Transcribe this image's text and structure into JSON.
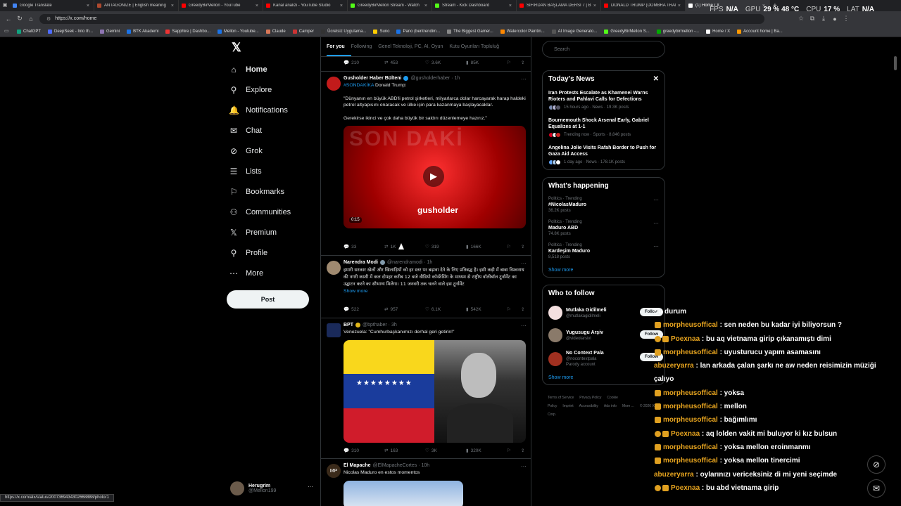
{
  "tabs": [
    {
      "label": "Google Translate",
      "color": "#4285f4"
    },
    {
      "label": "ANTAGONIZE | English meaning",
      "color": "#b04a2f"
    },
    {
      "label": "GreedyBirMellon - YouTube",
      "color": "#ff0000"
    },
    {
      "label": "Kanal analizi - YouTube Studio",
      "color": "#ff0000"
    },
    {
      "label": "GreedyBirMellon Stream - Watch",
      "color": "#53fc18"
    },
    {
      "label": "Stream - Kick Dashboard",
      "color": "#53fc18"
    },
    {
      "label": "SIFIRDAN BAŞLAMA DERSİ 7 | BU",
      "color": "#ff0000"
    },
    {
      "label": "DONALD TRUMP (DOMBRA TRAP",
      "color": "#ff0000"
    },
    {
      "label": "(1) Home / X",
      "color": "#ffffff"
    }
  ],
  "overlay": {
    "fps_label": "FPS",
    "fps": "N/A",
    "gpu_label": "GPU",
    "gpu": "29 % 48 °C",
    "cpu_label": "CPU",
    "cpu": "17 %",
    "lat_label": "LAT",
    "lat": "N/A"
  },
  "url": "https://x.com/home",
  "bookmarks": [
    "ChatGPT",
    "DeepSeek - Into th...",
    "Gemini",
    "BTK Akademi",
    "Sapphire | Dashbo...",
    "Mellon - Youtube...",
    "Claude",
    "Camper",
    "Ücretsiz Uygulama...",
    "Suno",
    "Pano (bentrendim...",
    "The Biggest Gamer...",
    "Watercolor Paintin...",
    "AI Image Generato...",
    "GreedyBirMellon S...",
    "greedybirmellon -...",
    "Home / X",
    "Account home | Ba..."
  ],
  "nav": [
    {
      "label": "Home",
      "icon": "home-icon",
      "glyph": "⌂"
    },
    {
      "label": "Explore",
      "icon": "search-icon",
      "glyph": "⚲"
    },
    {
      "label": "Notifications",
      "icon": "bell-icon",
      "glyph": "🔔"
    },
    {
      "label": "Chat",
      "icon": "mail-icon",
      "glyph": "✉"
    },
    {
      "label": "Grok",
      "icon": "grok-icon",
      "glyph": "⊘"
    },
    {
      "label": "Lists",
      "icon": "list-icon",
      "glyph": "☰"
    },
    {
      "label": "Bookmarks",
      "icon": "bookmark-icon",
      "glyph": "⚐"
    },
    {
      "label": "Communities",
      "icon": "people-icon",
      "glyph": "⚇"
    },
    {
      "label": "Premium",
      "icon": "x-premium-icon",
      "glyph": "𝕏"
    },
    {
      "label": "Profile",
      "icon": "person-icon",
      "glyph": "⚲"
    },
    {
      "label": "More",
      "icon": "more-circle-icon",
      "glyph": "⋯"
    }
  ],
  "post_label": "Post",
  "user": {
    "name": "Herugrim",
    "handle": "@Mellon199"
  },
  "feed_tabs": [
    "For you",
    "Following",
    "Genel Teknoloji, PC, AI, Oyun",
    "Kutu Oyunları Topluluğ"
  ],
  "top_actions": [
    "210",
    "453",
    "3.6K",
    "85K"
  ],
  "posts": [
    {
      "name": "Gusholder Haber Bülteni",
      "handle": "@gusholderhaber · 1h",
      "tag": "#SONDAKİKA",
      "line1": " Donald Trump:",
      "p2": "\"Dünyanın en büyük ABD'li petrol şirketleri, milyarlarca dolar harcayarak harap haldeki petrol altyapısını onaracak ve ülke için para kazanmaya başlayacaklar.",
      "p3": "Gerekirse ikinci ve çok daha büyük bir saldırı düzenlemeye hazırız.\"",
      "video_time": "0:15",
      "video_text": "SON DAKİ",
      "video_brand": "gusholder",
      "actions": [
        "33",
        "1K",
        "319",
        "166K"
      ]
    },
    {
      "name": "Narendra Modi",
      "handle": "@narendramodi · 1h",
      "text": "हमारी सरकार खेलों और खिलाड़ियों को हर स्तर पर बढ़ावा देने के लिए प्रतिबद्ध है। इसी कड़ी में बाबा विश्वनाथ की नगरी काशी में कल दोपहर करीब 12 बजे वीडियो कॉन्फ्रेंसिंग के माध्यम से राष्ट्रीय वॉलीबॉल टूर्नामेंट का उद्घाटन करने का सौभाग्य मिलेगा। 11 जनवरी तक चलने वाले इस टूर्नामेंट",
      "show_more": "Show more",
      "actions": [
        "522",
        "957",
        "6.1K",
        "542K"
      ]
    },
    {
      "name": "BPT",
      "handle": "@bpthaber · 3h",
      "text": "Venezuela: \"Cumhurbaşkanımızı derhal geri getirin!\"",
      "actions": [
        "310",
        "163",
        "3K",
        "320K"
      ]
    },
    {
      "name": "El Mapache",
      "handle": "@ElMapacheCortes · 10h",
      "text": "Nicolas Maduro en estos momentos"
    }
  ],
  "search_placeholder": "Search",
  "todays_news": {
    "title": "Today's News",
    "items": [
      {
        "title": "Iran Protests Escalate as Khamenei Warns Rioters and Pahlavi Calls for Defections",
        "meta": "15 hours ago · News · 19.3K posts"
      },
      {
        "title": "Bournemouth Shock Arsenal Early, Gabriel Equalizes at 1-1",
        "meta": "Trending now · Sports · 8,846 posts"
      },
      {
        "title": "Angelina Jolie Visits Rafah Border to Push for Gaza Aid Access",
        "meta": "1 day ago · News · 178.1K posts"
      }
    ]
  },
  "happening": {
    "title": "What's happening",
    "items": [
      {
        "cat": "Politics · Trending",
        "name": "#NicolasMaduro",
        "posts": "36.2K posts"
      },
      {
        "cat": "Politics · Trending",
        "name": "Maduro ABD",
        "posts": "74.8K posts"
      },
      {
        "cat": "Politics · Trending",
        "name": "Kardeşim Maduro",
        "posts": "8,518 posts"
      }
    ],
    "show_more": "Show more"
  },
  "who_to_follow": {
    "title": "Who to follow",
    "items": [
      {
        "name": "Mutlaka Gidilmeli",
        "handle": "@mutlakagidilmeli",
        "extra": ""
      },
      {
        "name": "Yugusugu Arşiv",
        "handle": "@videolarsivi",
        "extra": ""
      },
      {
        "name": "No Context Pala",
        "handle": "@nocontextpala",
        "extra": "Parody account"
      }
    ],
    "follow_label": "Follow",
    "show_more": "Show more"
  },
  "footer": [
    "Terms of Service",
    "Privacy Policy",
    "Cookie Policy",
    "Imprint",
    "Accessibility",
    "Ads info",
    "More ...",
    "© 2026 X Corp."
  ],
  "chat": [
    {
      "user": "",
      "msg": "bu durum",
      "badge": 0
    },
    {
      "user": "morpheusoffical",
      "msg": " : sen neden bu kadar iyi biliyorsun ?",
      "badge": 1
    },
    {
      "user": "Poexnaa",
      "msg": " : bu aq vietnama girip çıkanamıştı dimi",
      "badge": 2
    },
    {
      "user": "morpheusoffical",
      "msg": " : uyusturucu yapım asamasını",
      "badge": 1
    },
    {
      "user": "abuzeryarra",
      "msg": " : lan arkada çalan şarkı ne aw neden reisimizin müziği çalıyo",
      "badge": 0
    },
    {
      "user": "morpheusoffical",
      "msg": " : yoksa",
      "badge": 1
    },
    {
      "user": "morpheusoffical",
      "msg": " : mellon",
      "badge": 1
    },
    {
      "user": "morpheusoffical",
      "msg": " : bağımlımı",
      "badge": 1
    },
    {
      "user": "Poexnaa",
      "msg": " : aq lolden vakit mi buluyor ki kız bulsun",
      "badge": 2
    },
    {
      "user": "morpheusoffical",
      "msg": " : yoksa mellon eroinmanmı",
      "badge": 1
    },
    {
      "user": "morpheusoffical",
      "msg": " : yoksa mellon tinercimi",
      "badge": 1
    },
    {
      "user": "abuzeryarra",
      "msg": " : oylarınızı vericeksiniz di mi yeni seçimde",
      "badge": 0
    },
    {
      "user": "Poexnaa",
      "msg": " : bu abd vietnama girip",
      "badge": 2
    }
  ],
  "status_url": "https://x.com/alx/status/2007369434302668888/photo/1"
}
